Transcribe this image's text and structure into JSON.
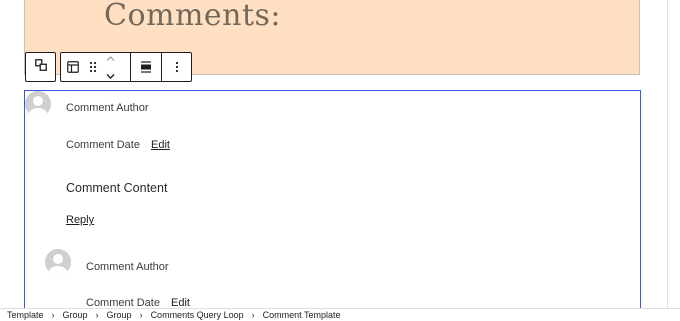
{
  "heading": {
    "text": "Comments:"
  },
  "toolbar": {
    "select_parent_icon": "select-parent-icon",
    "block_icon": "layout-icon",
    "drag_icon": "drag-handle-icon",
    "move_up_icon": "chevron-up-icon",
    "move_down_icon": "chevron-down-icon",
    "align_icon": "align-wide-icon",
    "options_icon": "more-vertical-icon"
  },
  "comments": [
    {
      "author": "Comment Author",
      "date": "Comment Date",
      "edit": "Edit",
      "content": "Comment Content",
      "reply": "Reply"
    },
    {
      "author": "Comment Author",
      "date": "Comment Date",
      "edit": "Edit"
    }
  ],
  "breadcrumb": {
    "items": [
      "Template",
      "Group",
      "Group",
      "Comments Query Loop",
      "Comment Template"
    ],
    "separator": "›"
  },
  "colors": {
    "heading_bg": "#ffe0c2",
    "selection_border": "#3858e9"
  }
}
